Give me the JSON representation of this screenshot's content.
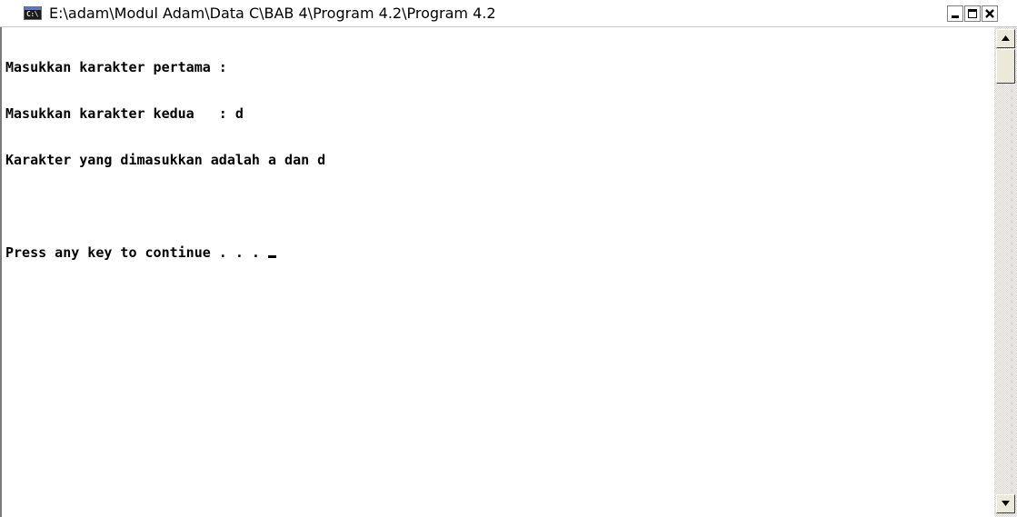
{
  "window": {
    "title": "E:\\adam\\Modul Adam\\Data C\\BAB 4\\Program 4.2\\Program 4.2",
    "icon": "console-icon",
    "icon_text": "C:\\"
  },
  "console": {
    "lines": [
      "Masukkan karakter pertama :",
      "Masukkan karakter kedua   : d",
      "Karakter yang dimasukkan adalah a dan d",
      "",
      "Press any key to continue . . . "
    ]
  },
  "controls": {
    "minimize": "minimize-icon",
    "maximize": "maximize-icon",
    "close": "close-icon"
  }
}
